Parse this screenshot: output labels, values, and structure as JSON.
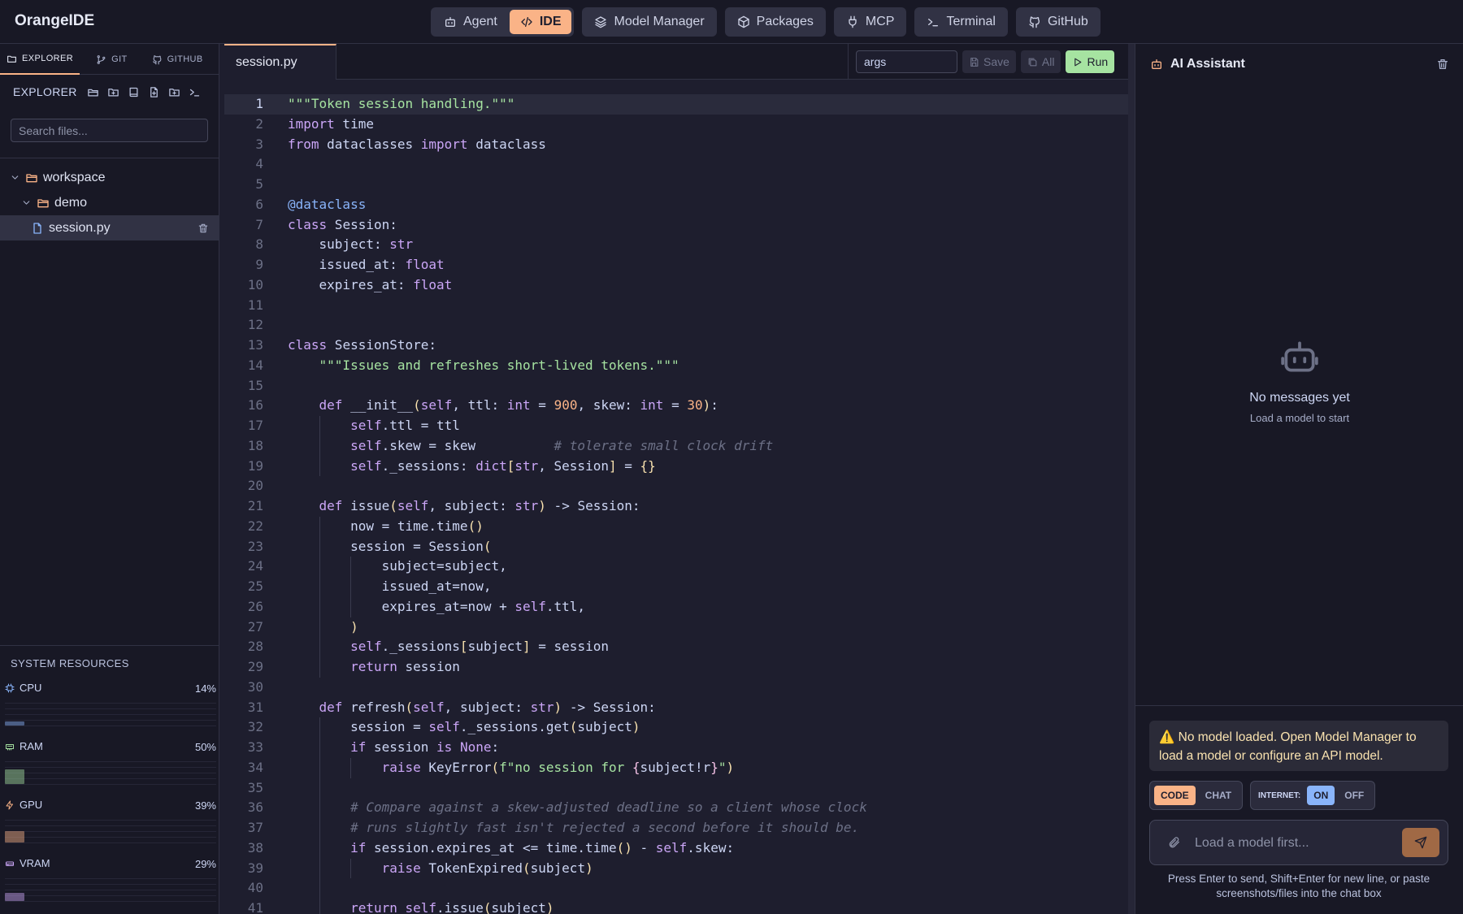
{
  "app": {
    "title": "OrangeIDE"
  },
  "nav": {
    "agent": "Agent",
    "ide": "IDE",
    "model_manager": "Model Manager",
    "packages": "Packages",
    "mcp": "MCP",
    "terminal": "Terminal",
    "github": "GitHub",
    "active": "IDE"
  },
  "sidebar": {
    "tabs": [
      {
        "label": "EXPLORER",
        "active": true
      },
      {
        "label": "GIT"
      },
      {
        "label": "GITHUB"
      }
    ],
    "explorer_title": "EXPLORER",
    "search": {
      "placeholder": "Search files...",
      "value": ""
    },
    "tree": [
      {
        "name": "workspace",
        "type": "folder",
        "expanded": true
      },
      {
        "name": "demo",
        "type": "folder",
        "expanded": true
      },
      {
        "name": "session.py",
        "type": "file",
        "selected": true
      }
    ],
    "resources": {
      "title": "SYSTEM RESOURCES",
      "items": [
        {
          "name": "CPU",
          "value": "14%",
          "fraction": 0.14,
          "color": "#89b4fa"
        },
        {
          "name": "RAM",
          "value": "50%",
          "fraction": 0.5,
          "color": "#a6e3a1"
        },
        {
          "name": "GPU",
          "value": "39%",
          "fraction": 0.39,
          "color": "#fab387"
        },
        {
          "name": "VRAM",
          "value": "29%",
          "fraction": 0.29,
          "color": "#cba6f7"
        }
      ]
    }
  },
  "editor": {
    "tab": "session.py",
    "args": {
      "value": "args"
    },
    "save_label": "Save",
    "all_label": "All",
    "run_label": "Run",
    "current_line": 1,
    "lines": [
      "\"\"\"Token session handling.\"\"\"",
      "import time",
      "from dataclasses import dataclass",
      "",
      "",
      "@dataclass",
      "class Session:",
      "    subject: str",
      "    issued_at: float",
      "    expires_at: float",
      "",
      "",
      "class SessionStore:",
      "    \"\"\"Issues and refreshes short-lived tokens.\"\"\"",
      "",
      "    def __init__(self, ttl: int = 900, skew: int = 30):",
      "        self.ttl = ttl",
      "        self.skew = skew          # tolerate small clock drift",
      "        self._sessions: dict[str, Session] = {}",
      "",
      "    def issue(self, subject: str) -> Session:",
      "        now = time.time()",
      "        session = Session(",
      "            subject=subject,",
      "            issued_at=now,",
      "            expires_at=now + self.ttl,",
      "        )",
      "        self._sessions[subject] = session",
      "        return session",
      "",
      "    def refresh(self, subject: str) -> Session:",
      "        session = self._sessions.get(subject)",
      "        if session is None:",
      "            raise KeyError(f\"no session for {subject!r}\")",
      "",
      "        # Compare against a skew-adjusted deadline so a client whose clock",
      "        # runs slightly fast isn't rejected a second before it should be.",
      "        if session.expires_at <= time.time() - self.skew:",
      "            raise TokenExpired(subject)",
      "",
      "        return self.issue(subject)"
    ]
  },
  "assistant": {
    "title": "AI Assistant",
    "empty_title": "No messages yet",
    "empty_subtitle": "Load a model to start",
    "warning": "No model loaded. Open Model Manager to load a model or configure an API model.",
    "mode": {
      "code": "CODE",
      "chat": "CHAT",
      "selected": "CODE"
    },
    "internet": {
      "label": "INTERNET:",
      "on": "ON",
      "off": "OFF",
      "selected": "ON"
    },
    "input": {
      "placeholder": "Load a model first...",
      "value": ""
    },
    "hint": "Press Enter to send, Shift+Enter for new line, or paste screenshots/files into the chat box"
  },
  "colors": {
    "accent": "#fab387",
    "run": "#a6e3a1",
    "info": "#89b4fa",
    "warning": "#f9e2af"
  }
}
